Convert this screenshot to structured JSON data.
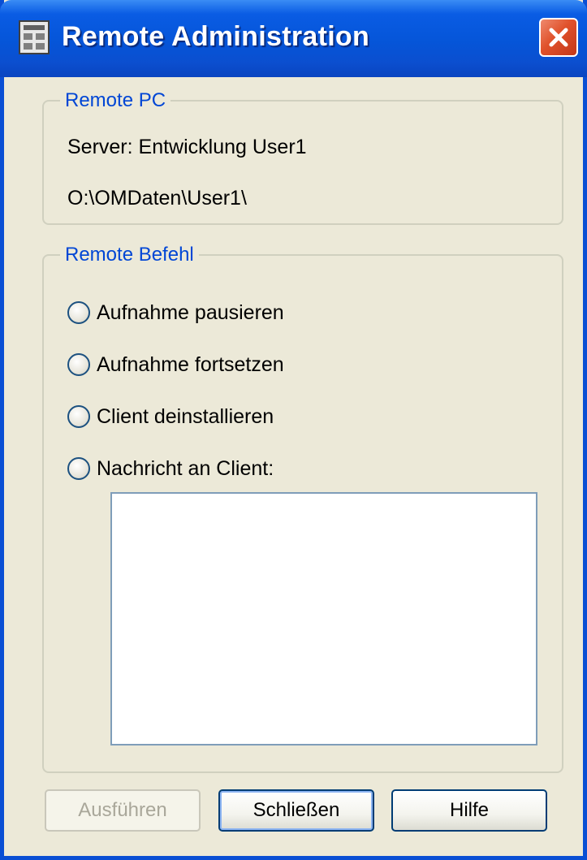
{
  "window": {
    "title": "Remote Administration",
    "icon": "app-icon",
    "close_icon": "close-icon"
  },
  "remote_pc": {
    "legend": "Remote PC",
    "server": "Server: Entwicklung User1",
    "path": "O:\\OMDaten\\User1\\"
  },
  "remote_command": {
    "legend": "Remote Befehl",
    "options": [
      {
        "label": "Aufnahme pausieren",
        "selected": false
      },
      {
        "label": "Aufnahme fortsetzen",
        "selected": false
      },
      {
        "label": "Client deinstallieren",
        "selected": false
      },
      {
        "label": "Nachricht an Client:",
        "selected": false
      }
    ],
    "message_value": ""
  },
  "buttons": {
    "execute": "Ausführen",
    "close": "Schließen",
    "help": "Hilfe"
  },
  "colors": {
    "titlebar": "#0555d8",
    "group_label": "#0046d5",
    "dialog_bg": "#ece9d8",
    "close_button": "#e0512b"
  }
}
